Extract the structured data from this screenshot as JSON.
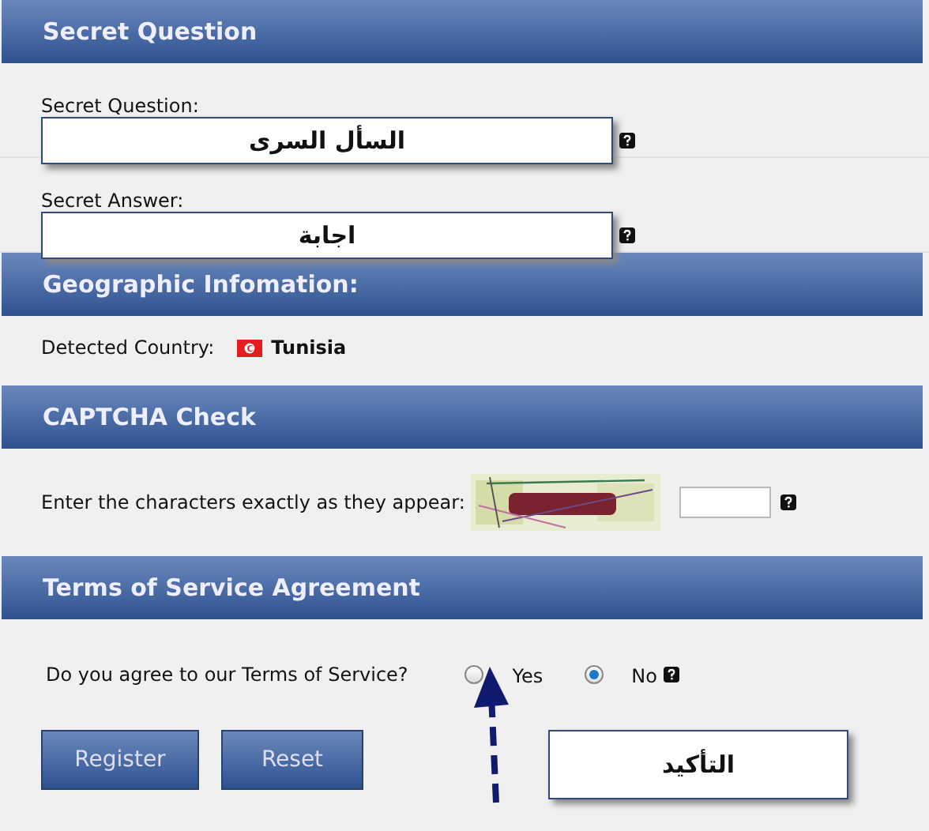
{
  "sections": [
    {
      "kind": "secret",
      "title": "Secret Question",
      "fields": [
        {
          "label": "Secret Question:",
          "callout": "السأل السرى"
        },
        {
          "label": "Secret Answer:",
          "callout": "اجابة"
        }
      ]
    },
    {
      "kind": "geo",
      "title": "Geographic Infomation:",
      "label": "Detected Country:",
      "country": "Tunisia"
    },
    {
      "kind": "captcha",
      "title": "CAPTCHA Check",
      "label": "Enter the characters exactly as they appear:"
    },
    {
      "kind": "terms",
      "title": "Terms of Service Agreement",
      "question": "Do you agree to our Terms of Service?",
      "options": [
        {
          "label": "Yes",
          "selected": false
        },
        {
          "label": "No",
          "selected": true
        }
      ]
    }
  ],
  "buttons": [
    "Register",
    "Reset"
  ],
  "callout": "التأكيد"
}
